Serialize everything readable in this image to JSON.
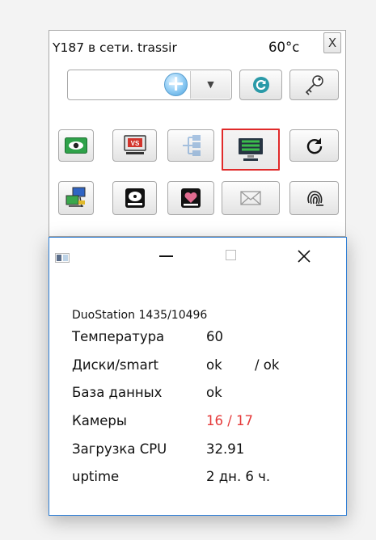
{
  "widget": {
    "title": "Y187 в сети. trassir",
    "temperature": "60°c",
    "close_label": "X",
    "combo": {
      "value": ""
    },
    "icons_row2": [
      "add-circle-icon",
      "dropdown-arrow-icon",
      "refresh-circle-icon",
      "key-icon"
    ],
    "icons_row3": [
      "eye-icon",
      "video-record-icon",
      "network-tree-icon",
      "monitor-icon",
      "reload-icon"
    ],
    "icons_row4": [
      "network-computers-icon",
      "hard-disk-icon",
      "disk-health-icon",
      "mail-icon",
      "fingerprint-icon"
    ],
    "selected_icon": "monitor-icon"
  },
  "window": {
    "icon": "app-window-icon",
    "controls": [
      "minimize-icon",
      "maximize-icon",
      "close-icon"
    ],
    "device": "DuoStation 1435/10496",
    "rows": [
      {
        "label": "Температура",
        "value": "60"
      },
      {
        "label": "Диски/smart",
        "value": "ok",
        "value2": "/ ok"
      },
      {
        "label": "База данных",
        "value": "ok"
      },
      {
        "label": "Камеры",
        "value": "16 / 17"
      },
      {
        "label": "Загрузка CPU",
        "value": "32.91"
      },
      {
        "label": "uptime",
        "value": "2 дн. 6 ч."
      }
    ]
  },
  "colors": {
    "selection_border": "#e02a2a",
    "window_border": "#2f7fd6",
    "alert_text": "#e53a3a"
  }
}
